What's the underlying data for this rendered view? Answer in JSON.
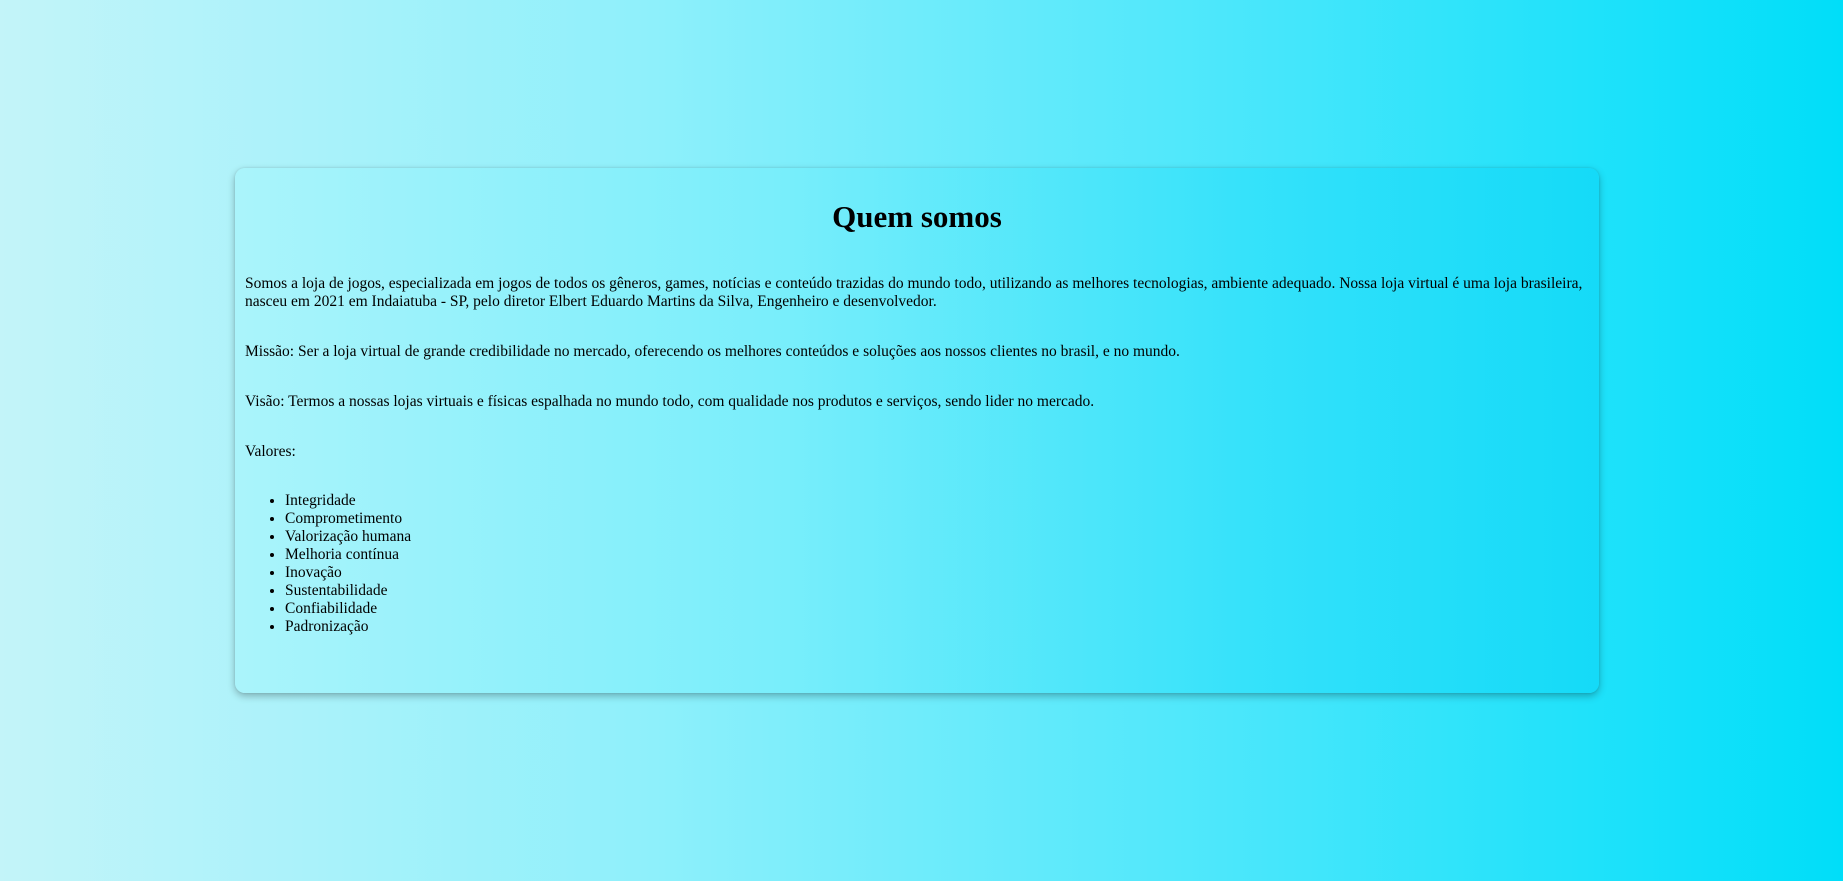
{
  "about": {
    "title": "Quem somos",
    "intro": "Somos a loja de jogos, especializada em jogos de todos os gêneros, games, notícias e conteúdo trazidas do mundo todo, utilizando as melhores tecnologias, ambiente adequado. Nossa loja virtual é uma loja brasileira, nasceu em 2021 em Indaiatuba - SP, pelo diretor Elbert Eduardo Martins da Silva, Engenheiro e desenvolvedor.",
    "mission": "Missão: Ser a loja virtual de grande credibilidade no mercado, oferecendo os melhores conteúdos e soluções aos nossos clientes no brasil, e no mundo.",
    "vision": "Visão: Termos a nossas lojas virtuais e físicas espalhada no mundo todo, com qualidade nos produtos e serviços, sendo lider no mercado.",
    "values_label": "Valores:",
    "values": [
      "Integridade",
      "Comprometimento",
      "Valorização humana",
      "Melhoria contínua",
      "Inovação",
      "Sustentabilidade",
      "Confiabilidade",
      "Padronização"
    ]
  }
}
